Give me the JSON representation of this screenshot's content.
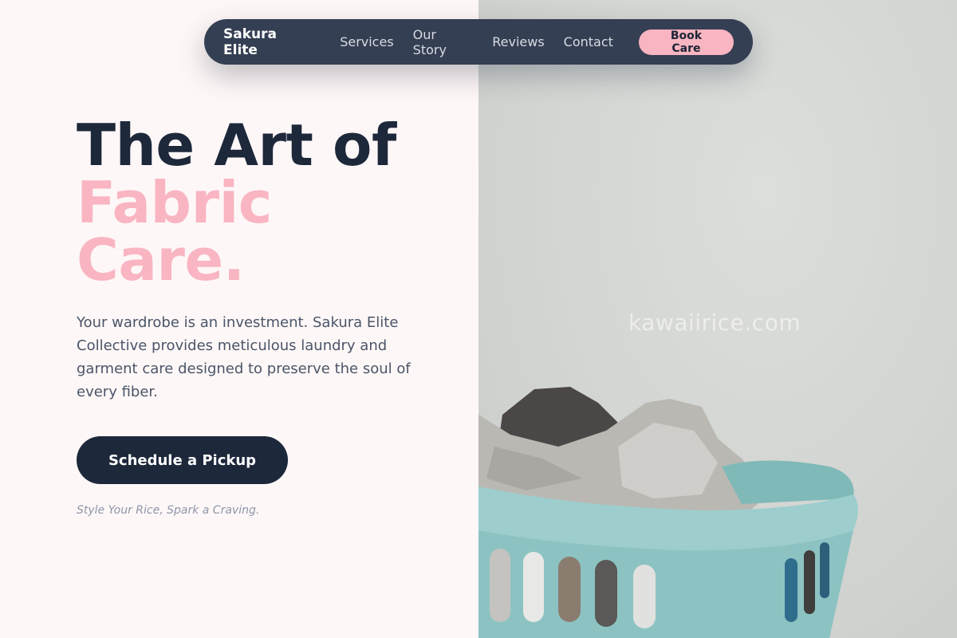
{
  "nav": {
    "brand": "Sakura Elite",
    "links": [
      "Services",
      "Our Story",
      "Reviews",
      "Contact"
    ],
    "cta": "Book Care"
  },
  "hero": {
    "title_line1": "The Art of",
    "title_line2": "Fabric",
    "title_line3": "Care.",
    "description": "Your wardrobe is an investment. Sakura Elite Collective provides meticulous laundry and garment care designed to preserve the soul of every fiber.",
    "cta": "Schedule a Pickup",
    "tagline": "Style Your Rice, Spark a Craving."
  },
  "image": {
    "watermark": "kawaiirice.com"
  },
  "colors": {
    "navy": "#1e283b",
    "nav_bg": "#353f53",
    "pink": "#f9b5c1",
    "page_bg": "#fef7f7",
    "basket": "#8fc6c4"
  }
}
